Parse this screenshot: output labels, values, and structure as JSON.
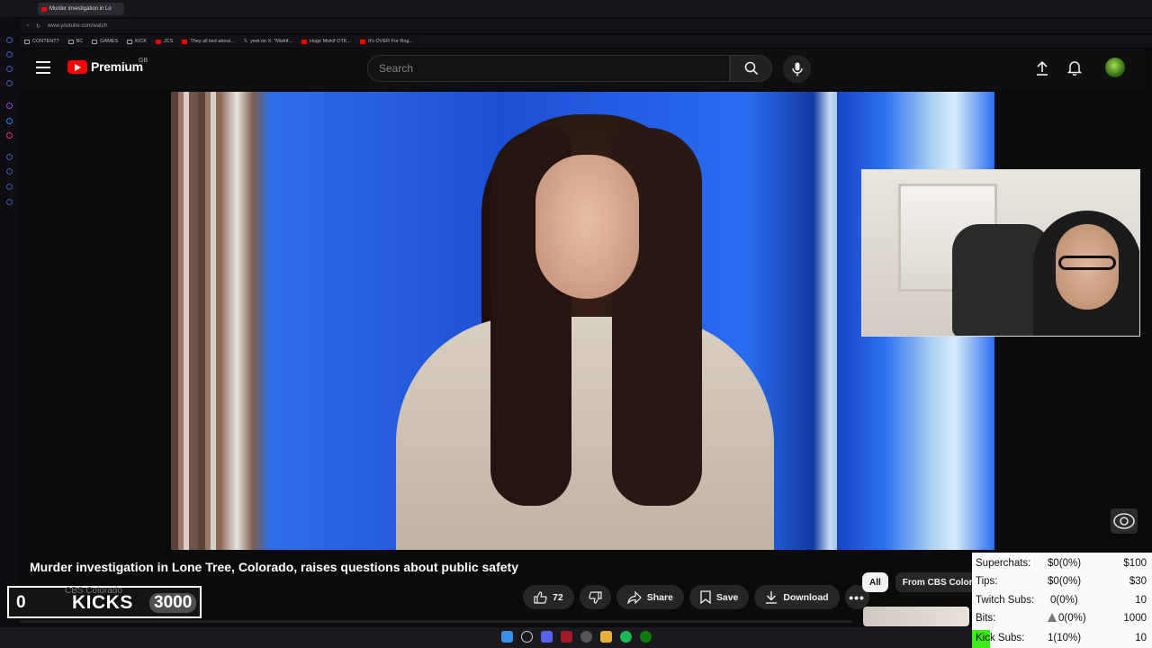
{
  "browser": {
    "tab_title": "Murder investigation in Lo",
    "url": "www.youtube.com/watch",
    "bookmarks": [
      "CONTENT?",
      "BC",
      "GAMES",
      "KICK",
      "JCS",
      "They all lied about...",
      "yeet on X: \"Mizkif...",
      "Huge Mizkif OTK...",
      "It's OVER For Rog..."
    ]
  },
  "youtube": {
    "logo_text": "Premium",
    "logo_region": "GB",
    "search_placeholder": "Search"
  },
  "video": {
    "title": "Murder investigation in Lone Tree, Colorado, raises questions about public safety",
    "channel": "CBS Colorado",
    "likes": "72",
    "share_label": "Share",
    "save_label": "Save",
    "download_label": "Download"
  },
  "overlay": {
    "kicks_count": "0",
    "kicks_label": "KICKS",
    "kicks_goal": "3000"
  },
  "chips": [
    "All",
    "From CBS Colora"
  ],
  "stats": [
    {
      "label": "Superchats:",
      "value": "$0(0%)",
      "goal": "$100"
    },
    {
      "label": "Tips:",
      "value": "$0(0%)",
      "goal": "$30"
    },
    {
      "label": "Twitch Subs:",
      "value": "0(0%)",
      "goal": "10"
    },
    {
      "label": "Bits:",
      "value": "0(0%)",
      "goal": "1000"
    },
    {
      "label": "Kick Subs:",
      "value": "1(10%)",
      "goal": "10"
    }
  ],
  "colors": {
    "brand_red": "#ff0000",
    "kick_green": "#3dea19"
  }
}
